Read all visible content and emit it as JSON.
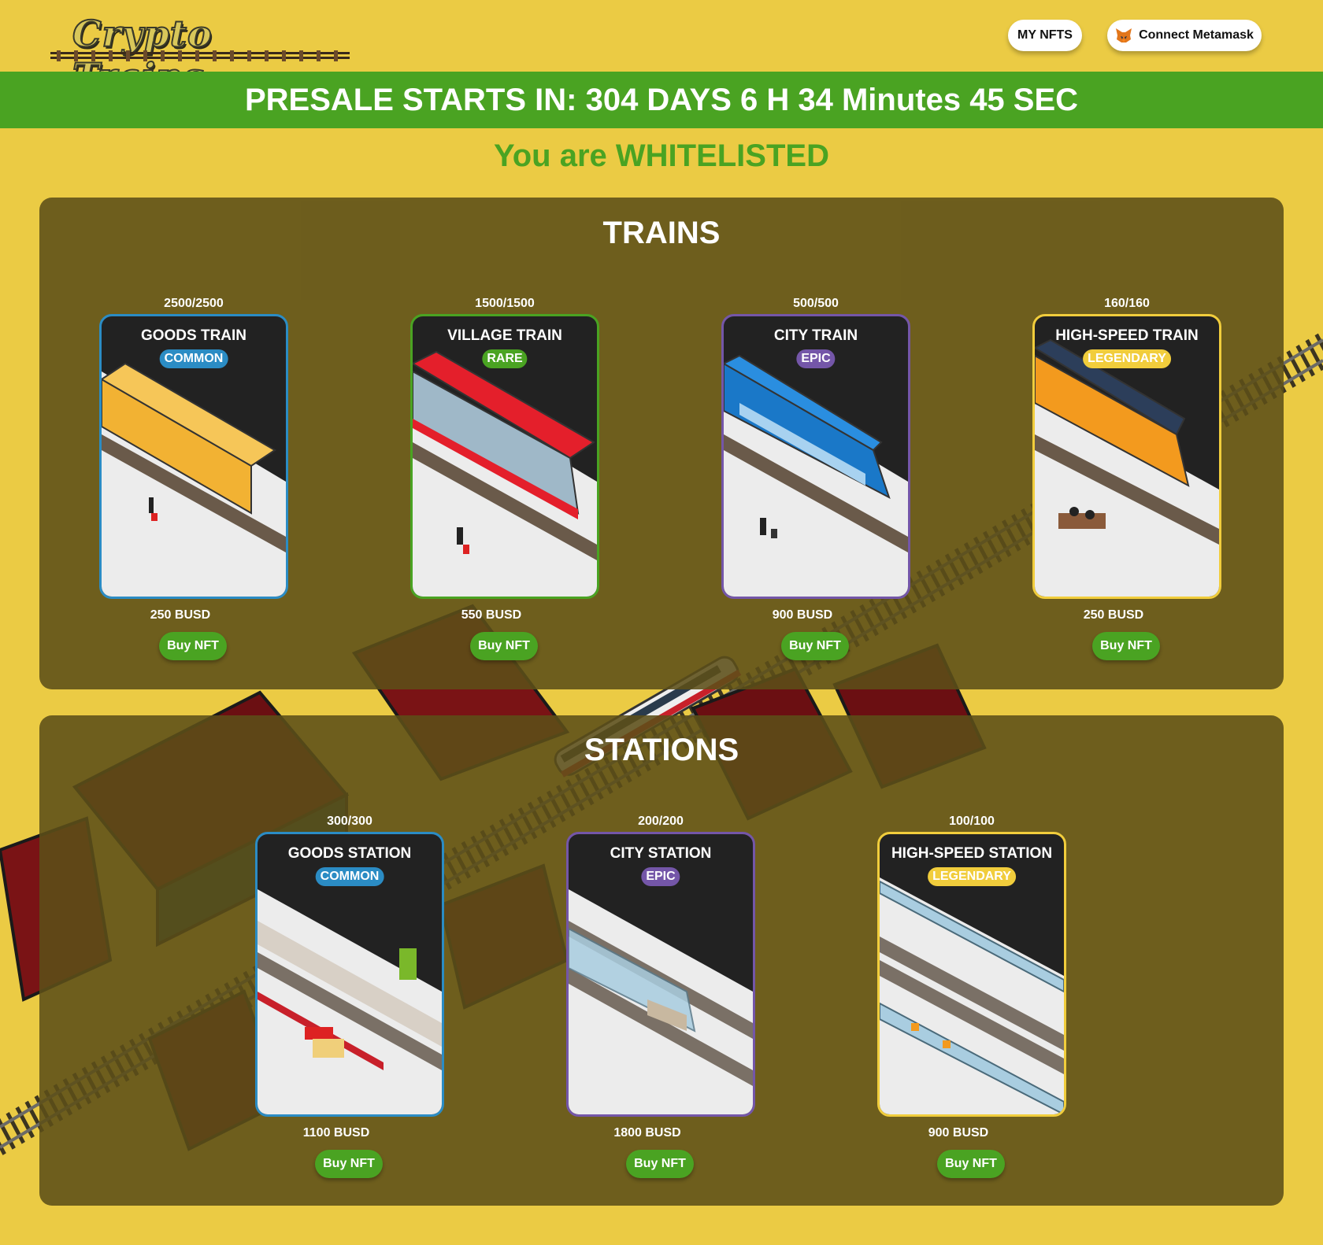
{
  "header": {
    "logo_text": "Crypto Trains",
    "my_nfts_label": "MY NFTS",
    "connect_label": "Connect Metamask"
  },
  "presale": {
    "text": "PRESALE STARTS IN: 304 DAYS 6 H 34 Minutes 45 SEC"
  },
  "whitelist": {
    "text": "You are WHITELISTED"
  },
  "trains": {
    "title": "TRAINS",
    "items": [
      {
        "supply": "2500/2500",
        "name": "GOODS TRAIN",
        "rarity": "COMMON",
        "price": "250 BUSD",
        "buy_label": "Buy NFT"
      },
      {
        "supply": "1500/1500",
        "name": "VILLAGE TRAIN",
        "rarity": "RARE",
        "price": "550 BUSD",
        "buy_label": "Buy NFT"
      },
      {
        "supply": "500/500",
        "name": "CITY TRAIN",
        "rarity": "EPIC",
        "price": "900 BUSD",
        "buy_label": "Buy NFT"
      },
      {
        "supply": "160/160",
        "name": "HIGH-SPEED TRAIN",
        "rarity": "LEGENDARY",
        "price": "250 BUSD",
        "buy_label": "Buy NFT"
      }
    ]
  },
  "stations": {
    "title": "STATIONS",
    "items": [
      {
        "supply": "300/300",
        "name": "GOODS STATION",
        "rarity": "COMMON",
        "price": "1100 BUSD",
        "buy_label": "Buy NFT"
      },
      {
        "supply": "200/200",
        "name": "CITY STATION",
        "rarity": "EPIC",
        "price": "1800 BUSD",
        "buy_label": "Buy NFT"
      },
      {
        "supply": "100/100",
        "name": "HIGH-SPEED STATION",
        "rarity": "LEGENDARY",
        "price": "900 BUSD",
        "buy_label": "Buy NFT"
      }
    ]
  },
  "colors": {
    "background": "#ebcb44",
    "presale_bar": "#4aa322",
    "common": "#2b8cc4",
    "rare": "#4aa322",
    "epic": "#7456a8",
    "legendary": "#f1cd3c"
  },
  "icons": {
    "metamask": "fox-icon"
  }
}
